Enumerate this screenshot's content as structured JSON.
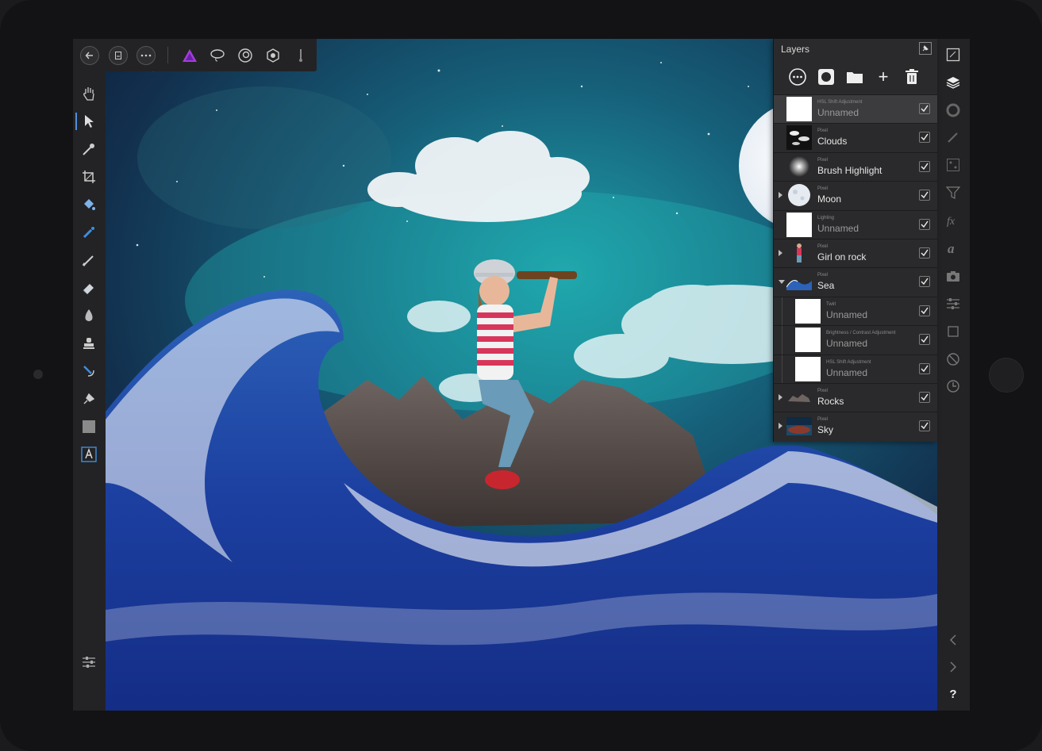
{
  "app": {
    "screen_aspect": "iPad",
    "accent_color": "#4e8fe0"
  },
  "topbar": {
    "buttons": [
      {
        "name": "back",
        "icon": "arrow-left-icon"
      },
      {
        "name": "document",
        "icon": "document-icon"
      },
      {
        "name": "more",
        "icon": "ellipsis-icon"
      }
    ],
    "personas": [
      {
        "name": "photo-persona",
        "icon": "affinity-photo-icon",
        "color": "#a33dd9"
      },
      {
        "name": "selection",
        "icon": "lasso-icon"
      },
      {
        "name": "liquify",
        "icon": "liquify-icon"
      },
      {
        "name": "develop",
        "icon": "aperture-icon"
      },
      {
        "name": "tone-mapping",
        "icon": "tone-map-icon"
      }
    ]
  },
  "left_tools": [
    "hand-tool-icon",
    "move-tool-icon",
    "color-picker-icon",
    "crop-tool-icon",
    "flood-fill-icon",
    "selection-brush-icon",
    "paint-brush-icon",
    "eraser-icon",
    "dodge-icon",
    "clone-stamp-icon",
    "inpainting-icon",
    "pen-tool-icon",
    "rectangle-tool-icon",
    "text-tool-icon"
  ],
  "left_bottom": "context-toolbar-icon",
  "right_tools": [
    "navigator-icon",
    "layers-icon",
    "color-icon",
    "brushes-icon",
    "channels-icon",
    "adjustments-icon",
    "fx-icon",
    "text-styles-icon",
    "camera-icon",
    "sliders-icon",
    "transform-icon",
    "cancel-icon",
    "history-icon"
  ],
  "right_bottom": [
    "chevron-left-icon",
    "chevron-right-icon",
    "help-icon"
  ],
  "help_label": "?",
  "layers_panel": {
    "title": "Layers",
    "actions": [
      "layer-options-icon",
      "mask-icon",
      "group-icon",
      "add-layer-icon",
      "delete-layer-icon"
    ],
    "add_symbol": "+",
    "rows": [
      {
        "type": "HSL Shift Adjustment",
        "name": "Unnamed",
        "dim": true,
        "selected": true,
        "thumb": "white",
        "expander": "none",
        "indent": false
      },
      {
        "type": "Pixel",
        "name": "Clouds",
        "dim": false,
        "selected": false,
        "thumb": "clouds",
        "expander": "none",
        "indent": false
      },
      {
        "type": "Pixel",
        "name": "Brush Highlight",
        "dim": false,
        "selected": false,
        "thumb": "glow",
        "expander": "none",
        "indent": false
      },
      {
        "type": "Pixel",
        "name": "Moon",
        "dim": false,
        "selected": false,
        "thumb": "moon",
        "expander": "right",
        "indent": false
      },
      {
        "type": "Lighting",
        "name": "Unnamed",
        "dim": true,
        "selected": false,
        "thumb": "white",
        "expander": "none",
        "indent": false
      },
      {
        "type": "Pixel",
        "name": "Girl on rock",
        "dim": false,
        "selected": false,
        "thumb": "girl",
        "expander": "right",
        "indent": false
      },
      {
        "type": "Pixel",
        "name": "Sea",
        "dim": false,
        "selected": false,
        "thumb": "sea",
        "expander": "down",
        "indent": false
      },
      {
        "type": "Twirl",
        "name": "Unnamed",
        "dim": true,
        "selected": false,
        "thumb": "white",
        "expander": "none",
        "indent": true
      },
      {
        "type": "Brightness / Contrast Adjustment",
        "name": "Unnamed",
        "dim": true,
        "selected": false,
        "thumb": "white",
        "expander": "none",
        "indent": true
      },
      {
        "type": "HSL Shift Adjustment",
        "name": "Unnamed",
        "dim": true,
        "selected": false,
        "thumb": "white",
        "expander": "none",
        "indent": true
      },
      {
        "type": "Pixel",
        "name": "Rocks",
        "dim": false,
        "selected": false,
        "thumb": "rocks",
        "expander": "right",
        "indent": false
      },
      {
        "type": "Pixel",
        "name": "Sky",
        "dim": false,
        "selected": false,
        "thumb": "sky",
        "expander": "right",
        "indent": false
      }
    ]
  }
}
